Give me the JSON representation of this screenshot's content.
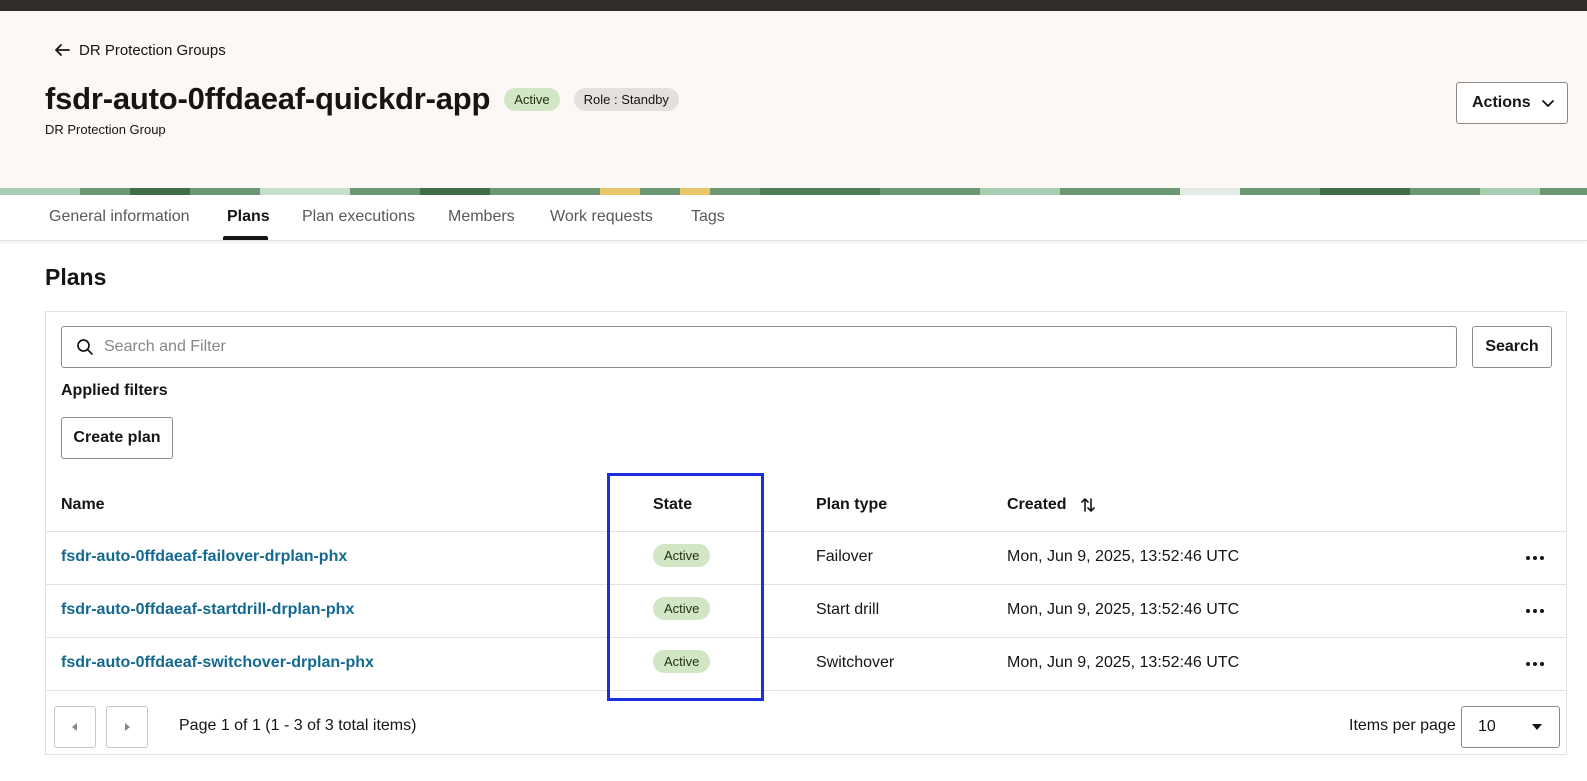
{
  "header": {
    "back_label": "DR Protection Groups",
    "title": "fsdr-auto-0ffdaeaf-quickdr-app",
    "status_badge": "Active",
    "role_badge": "Role : Standby",
    "subtitle": "DR Protection Group",
    "actions_label": "Actions"
  },
  "tabs": [
    {
      "label": "General information"
    },
    {
      "label": "Plans"
    },
    {
      "label": "Plan executions"
    },
    {
      "label": "Members"
    },
    {
      "label": "Work requests"
    },
    {
      "label": "Tags"
    }
  ],
  "active_tab": "Plans",
  "main": {
    "section_title": "Plans",
    "search": {
      "placeholder": "Search and Filter",
      "value": "",
      "button_label": "Search"
    },
    "applied_filters_label": "Applied filters",
    "create_label": "Create plan",
    "columns": {
      "name": "Name",
      "state": "State",
      "plan_type": "Plan type",
      "created": "Created"
    },
    "rows": [
      {
        "name": "fsdr-auto-0ffdaeaf-failover-drplan-phx",
        "state": "Active",
        "plan_type": "Failover",
        "created": "Mon, Jun 9, 2025, 13:52:46 UTC"
      },
      {
        "name": "fsdr-auto-0ffdaeaf-startdrill-drplan-phx",
        "state": "Active",
        "plan_type": "Start drill",
        "created": "Mon, Jun 9, 2025, 13:52:46 UTC"
      },
      {
        "name": "fsdr-auto-0ffdaeaf-switchover-drplan-phx",
        "state": "Active",
        "plan_type": "Switchover",
        "created": "Mon, Jun 9, 2025, 13:52:46 UTC"
      }
    ],
    "pagination": {
      "info": "Page 1 of 1 (1 - 3 of 3 total items)",
      "items_per_page_label": "Items per page",
      "items_per_page": "10"
    }
  },
  "colors": {
    "accent_link": "#146990",
    "badge_active": "#d1e6c4",
    "highlight_box": "#1b2ee0",
    "topbar": "#312d2a"
  },
  "icons": [
    "arrow-left-icon",
    "chevron-down-icon",
    "search-icon",
    "sort-icon",
    "kebab-menu-icon",
    "caret-left-icon",
    "caret-right-icon",
    "caret-down-icon"
  ]
}
